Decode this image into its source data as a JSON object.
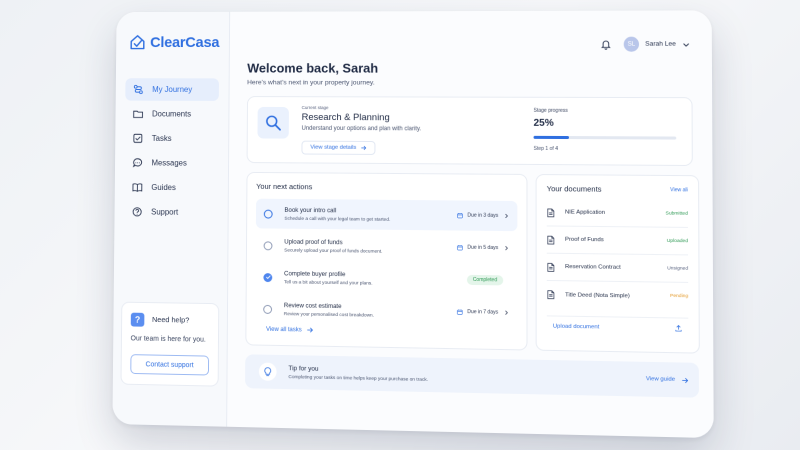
{
  "brand": {
    "name": "ClearCasa",
    "logo_icon": "house-check-icon",
    "accent": "#2f6fe0"
  },
  "sidebar": {
    "items": [
      {
        "label": "My Journey",
        "icon": "journey-icon",
        "active": true
      },
      {
        "label": "Documents",
        "icon": "folder-icon"
      },
      {
        "label": "Tasks",
        "icon": "checkbox-icon"
      },
      {
        "label": "Messages",
        "icon": "chat-icon"
      },
      {
        "label": "Guides",
        "icon": "book-icon"
      },
      {
        "label": "Support",
        "icon": "question-icon"
      }
    ],
    "help": {
      "title": "Need help?",
      "text": "Our team is here for you.",
      "button": "Contact support"
    }
  },
  "header": {
    "user_name": "Sarah Lee",
    "user_initials": "SL",
    "welcome": "Welcome back, Sarah",
    "subtitle": "Here’s what’s next in your property journey."
  },
  "stage": {
    "kicker": "Current stage",
    "title": "Research & Planning",
    "description": "Understand your options and plan with clarity.",
    "link": "View stage details",
    "progress_label": "Stage progress",
    "progress_text": "25%",
    "progress_value": 25,
    "step": "Step 1 of 4"
  },
  "actions": {
    "title": "Your next actions",
    "tasks": [
      {
        "title": "Book your intro call",
        "subtitle": "Schedule a call with your legal team to get started.",
        "due": "Due in 3 days",
        "state": "open-highlight"
      },
      {
        "title": "Upload proof of funds",
        "subtitle": "Securely upload your proof of funds document.",
        "due": "Due in 5 days",
        "state": "open"
      },
      {
        "title": "Complete buyer profile",
        "subtitle": "Tell us a bit about yourself and your plans.",
        "badge": "Completed",
        "state": "done"
      },
      {
        "title": "Review cost estimate",
        "subtitle": "Review your personalised cost breakdown.",
        "due": "Due in 7 days",
        "state": "open"
      }
    ],
    "view_all": "View all tasks"
  },
  "documents": {
    "title": "Your documents",
    "view_all": "View all",
    "items": [
      {
        "name": "NIE Application",
        "status": "Submitted",
        "color": "#2f9a55"
      },
      {
        "name": "Proof of Funds",
        "status": "Uploaded",
        "color": "#2f9a55"
      },
      {
        "name": "Reservation Contract",
        "status": "Unsigned",
        "color": "#5a6480"
      },
      {
        "name": "Title Deed (Nota Simple)",
        "status": "Pending",
        "color": "#e39a2a"
      }
    ],
    "upload": "Upload document"
  },
  "tip": {
    "title": "Tip for you",
    "text": "Completing your tasks on time helps keep your purchase on track.",
    "link": "View guide"
  }
}
